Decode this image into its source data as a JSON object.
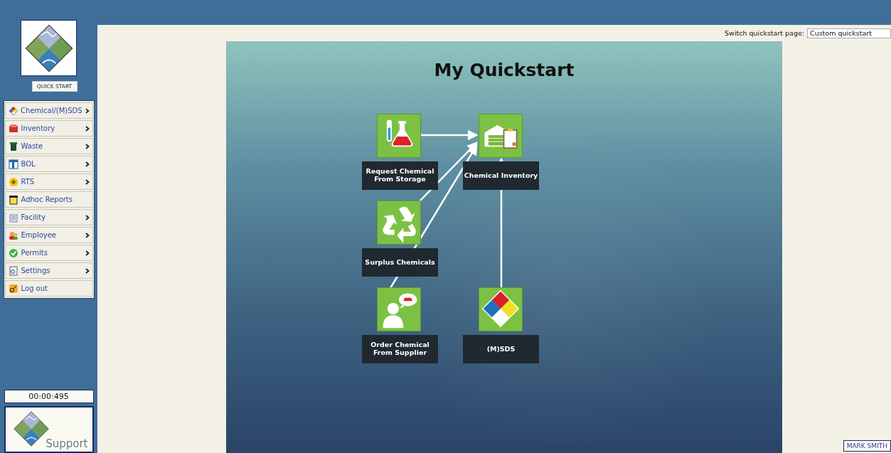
{
  "sidebar": {
    "quick_start_button": "QUICK START",
    "menu": [
      {
        "label": "Chemical/(M)SDS",
        "kind": "chemical",
        "has_submenu": true
      },
      {
        "label": "Inventory",
        "kind": "inventory",
        "has_submenu": true
      },
      {
        "label": "Waste",
        "kind": "waste",
        "has_submenu": true
      },
      {
        "label": "BOL",
        "kind": "bol",
        "has_submenu": true
      },
      {
        "label": "RTS",
        "kind": "rts",
        "has_submenu": true
      },
      {
        "label": "Adhoc Reports",
        "kind": "reports",
        "has_submenu": false
      },
      {
        "label": "Facility",
        "kind": "facility",
        "has_submenu": true
      },
      {
        "label": "Employee",
        "kind": "employee",
        "has_submenu": true
      },
      {
        "label": "Permits",
        "kind": "permits",
        "has_submenu": true
      },
      {
        "label": "Settings",
        "kind": "settings",
        "has_submenu": true
      },
      {
        "label": "Log out",
        "kind": "logout",
        "has_submenu": false
      }
    ],
    "timer": "00:00:495",
    "support": "Support"
  },
  "switch_quickstart": {
    "label": "Switch quickstart page:",
    "value": "Custom quickstart"
  },
  "quickstart": {
    "title": "My Quickstart",
    "nodes": [
      {
        "label": "Request Chemical From Storage",
        "kind": "flask"
      },
      {
        "label": "Chemical Inventory",
        "kind": "warehouse"
      },
      {
        "label": "Surplus Chemicals",
        "kind": "recycle"
      },
      {
        "label": "Order Chemical From Supplier",
        "kind": "person"
      },
      {
        "label": "(M)SDS",
        "kind": "diamond"
      }
    ]
  },
  "user": "MARK SMITH"
}
